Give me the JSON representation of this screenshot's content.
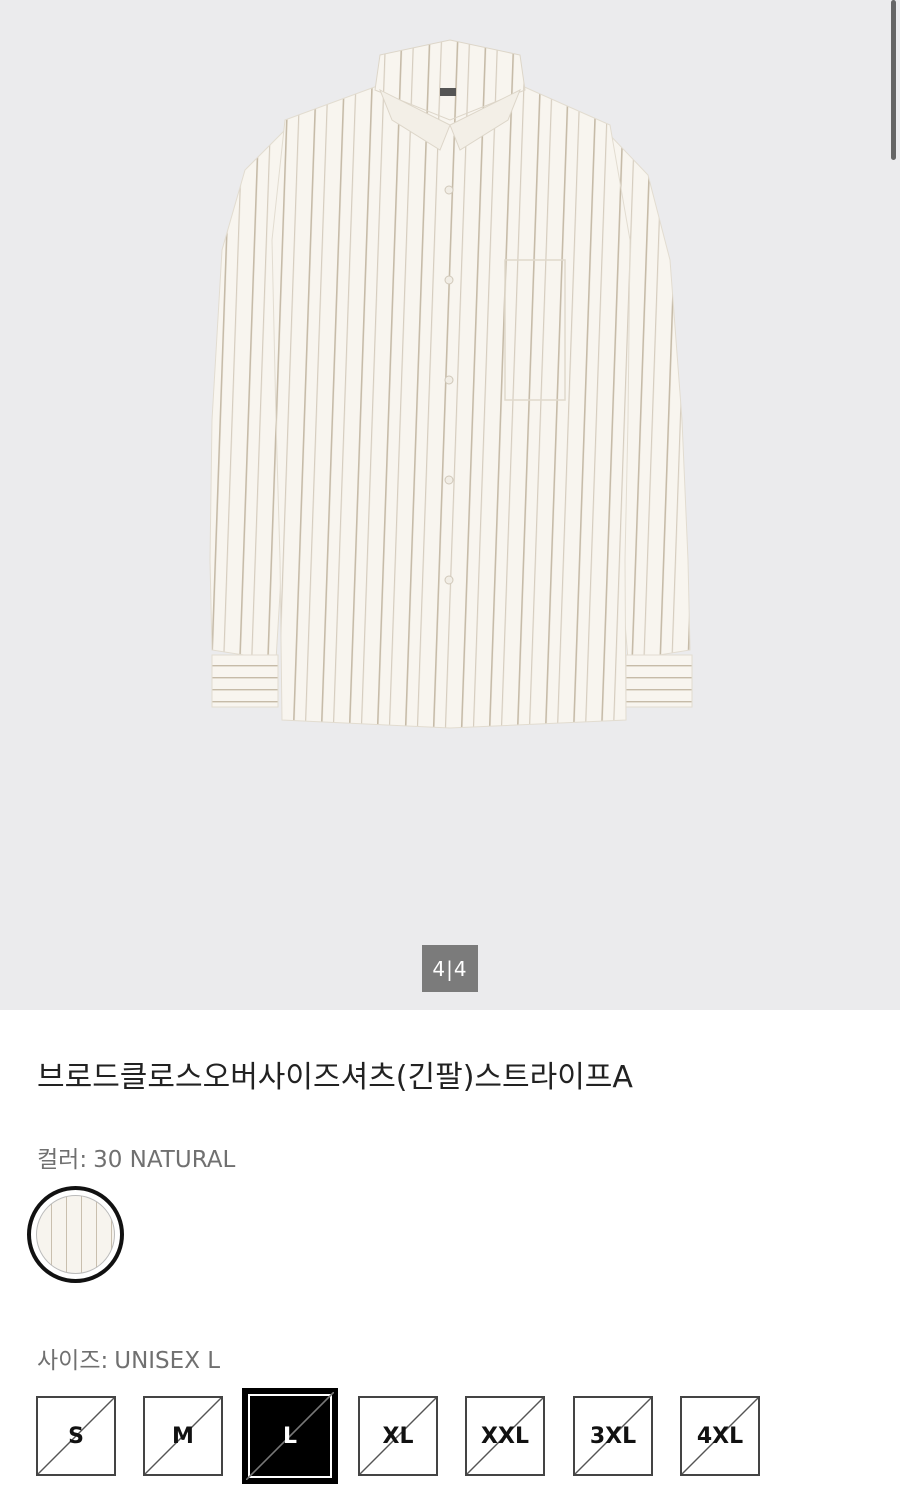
{
  "gallery": {
    "page_indicator": "4|4",
    "colors": {
      "background": "#ebebed",
      "shirt": "#f7f4ee",
      "stripe": "#c9bfae",
      "indicator_bg": "#7b7b7b"
    }
  },
  "product": {
    "title": "브로드클로스오버사이즈셔츠(긴팔)스트라이프A",
    "color_label": "컬러:",
    "color_value": "30 NATURAL",
    "size_label": "사이즈:",
    "size_value": "UNISEX L"
  },
  "sizes": [
    {
      "label": "S",
      "selected": false,
      "available": false
    },
    {
      "label": "M",
      "selected": false,
      "available": false
    },
    {
      "label": "L",
      "selected": true,
      "available": false
    },
    {
      "label": "XL",
      "selected": false,
      "available": false
    },
    {
      "label": "XXL",
      "selected": false,
      "available": false
    },
    {
      "label": "3XL",
      "selected": false,
      "available": false
    },
    {
      "label": "4XL",
      "selected": false,
      "available": false
    }
  ]
}
